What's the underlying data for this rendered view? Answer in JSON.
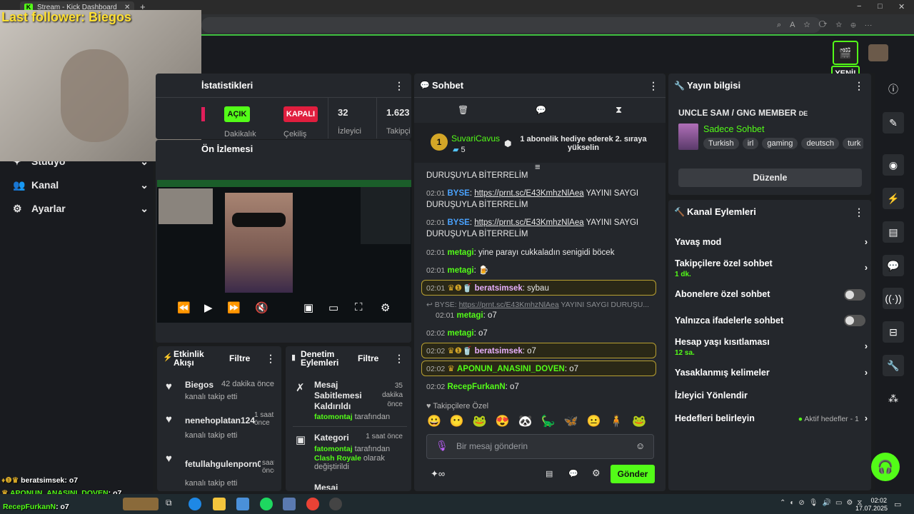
{
  "browser": {
    "tab_title": "Stream - Kick Dashboard",
    "new_tab": "+",
    "win_min": "−",
    "win_max": "□",
    "win_close": "✕"
  },
  "overlay": {
    "last_follower": "Last follower: Biegos",
    "chat_lines": [
      {
        "user": "beratsimsek",
        "msg": ": o7"
      },
      {
        "user": "APONUN_ANASINI_DOVEN",
        "msg": ": o7"
      },
      {
        "user": "RecepFurkanN",
        "msg": ": o7"
      }
    ]
  },
  "header": {
    "new_badge": "YENİ!"
  },
  "sidebar": {
    "items": [
      {
        "label": "Stüdyo"
      },
      {
        "label": "Kanal"
      },
      {
        "label": "Ayarlar"
      }
    ]
  },
  "stats": {
    "title": "İstatistikleri",
    "open": "AÇIK",
    "closed": "KAPALI",
    "viewers_val": "32",
    "viewers_lbl": "İzleyici",
    "followers_val": "1.623",
    "followers_lbl": "Takipçi",
    "dur_lbl": "Dakikalık",
    "slow_lbl": "Çekiliş"
  },
  "preview": {
    "title": "Ön İzlemesi"
  },
  "activity": {
    "title": "Etkinlik Akışı",
    "filter": "Filtre",
    "items": [
      {
        "name": "Biegos",
        "time": "42 dakika önce",
        "sub": "kanalı takip etti"
      },
      {
        "name": "nenehoplatan124",
        "time": "1 saat önce",
        "sub": "kanalı takip etti"
      },
      {
        "name": "fetullahgulenporn0",
        "time": "saat önce",
        "sub": "kanalı takip etti"
      }
    ]
  },
  "moderation": {
    "title": "Denetim Eylemleri",
    "filter": "Filtre",
    "items": [
      {
        "action": "Mesaj Sabitlemesi Kaldırıldı",
        "time": "35 dakika önce",
        "by": "fatomontaj",
        "by_suffix": "tarafından"
      },
      {
        "action": "Kategori",
        "time": "1 saat önce",
        "by": "fatomontaj",
        "by_suffix": "tarafından",
        "cat": "Clash Royale",
        "cat_suffix": "olarak değiştirildi"
      },
      {
        "action": "Mesaj"
      }
    ]
  },
  "chat": {
    "title": "Sohbet",
    "pinned_user": "SuvariCavus",
    "pinned_count": "5",
    "pinned_msg": "1 abonelik hediye ederek 2. sıraya yükselin",
    "messages": [
      {
        "time": "",
        "user": "",
        "text": "DURUŞUYLA BİTERRELİM"
      },
      {
        "time": "02:01",
        "user": "BYSE",
        "link": "https://prnt.sc/E43KmhzNlAea",
        "text": " YAYINI SAYGI DURUŞUYLA BİTERRELİM"
      },
      {
        "time": "02:01",
        "user": "BYSE",
        "link": "https://prnt.sc/E43KmhzNlAea",
        "text": " YAYINI SAYGI DURUŞUYLA BİTERRELİM"
      },
      {
        "time": "02:01",
        "user": "metagi",
        "text": ": yine parayı cukkaladın senigidi böcek"
      },
      {
        "time": "02:01",
        "user": "metagi",
        "text": ":"
      },
      {
        "time": "02:01",
        "user": "beratsimsek",
        "text": ": sybau"
      },
      {
        "time": "",
        "user": "BYSE",
        "link": "https://prnt.sc/E43KmhzNlAea",
        "text": " YAYINI SAYGI DURUŞU..."
      },
      {
        "time": "02:01",
        "user": "metagi",
        "text": ": o7"
      },
      {
        "time": "02:02",
        "user": "metagi",
        "text": ": o7"
      },
      {
        "time": "02:02",
        "user": "beratsimsek",
        "text": ": o7"
      },
      {
        "time": "02:02",
        "user": "APONUN_ANASINI_DOVEN",
        "text": ": o7"
      },
      {
        "time": "02:02",
        "user": "RecepFurkanN",
        "text": ": o7"
      }
    ],
    "emote_label": "Takipçilere Özel",
    "input_placeholder": "Bir mesaj gönderin",
    "send": "Gönder"
  },
  "stream_info": {
    "title": "Yayın bilgisi",
    "stream_title": "UNCLE SAM / GNG MEMBER",
    "lang": "DE",
    "category": "Sadece Sohbet",
    "tags": [
      "Turkish",
      "irl",
      "gaming",
      "deutsch",
      "turk"
    ],
    "edit": "Düzenle"
  },
  "channel_actions": {
    "title": "Kanal Eylemleri",
    "rows": [
      {
        "label": "Yavaş mod"
      },
      {
        "label": "Takipçilere özel sohbet",
        "sub": "1 dk."
      },
      {
        "label": "Abonelere özel sohbet"
      },
      {
        "label": "Yalnızca ifadelerle sohbet"
      },
      {
        "label": "Hesap yaşı kısıtlaması",
        "sub": "12 sa."
      },
      {
        "label": "Yasaklanmış kelimeler"
      },
      {
        "label": "İzleyici Yönlendir"
      },
      {
        "label": "Hedefleri belirleyin",
        "extra": "Aktif hedefler - 1"
      }
    ]
  },
  "taskbar": {
    "time": "02:02",
    "date": "17.07.2025"
  },
  "colors": {
    "accent": "#53fc18",
    "panel": "#24272c",
    "bg": "#1a1c1e"
  }
}
